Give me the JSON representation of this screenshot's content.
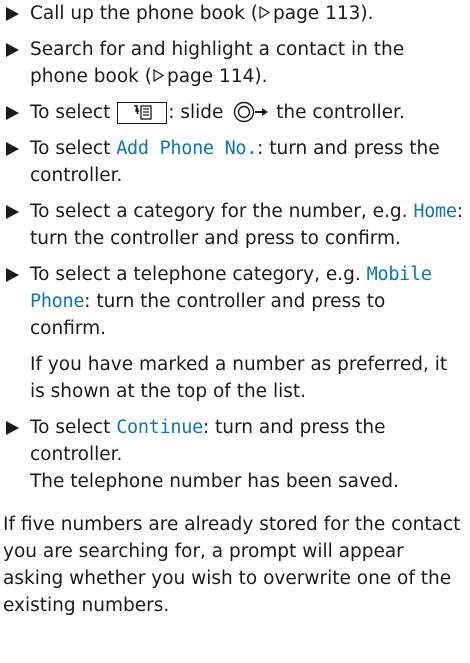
{
  "colors": {
    "text": "#1a1a1a",
    "highlight": "#0a78b4"
  },
  "icons": {
    "bullet": "triangle-right-bullet",
    "page_ref": "outline-triangle-right",
    "phone_book_entry": "phone-book-entry-icon",
    "controller": "controller-slide-icon"
  },
  "steps": [
    {
      "text_before": "Call up the phone book (",
      "ref": "page 113",
      "text_after": ")."
    },
    {
      "text_before": "Search for and highlight a contact in the phone book (",
      "ref": "page 114",
      "text_after": ")."
    },
    {
      "text_before": "To select ",
      "text_mid": ": slide ",
      "text_after": " the controller."
    },
    {
      "text_before": "To select ",
      "highlight": "Add Phone No.",
      "text_after": ": turn and press the controller."
    },
    {
      "text_before": "To select a category for the number, e.g. ",
      "highlight": "Home",
      "text_after": ": turn the controller and press to confirm."
    },
    {
      "text_before": "To select a telephone category, e.g. ",
      "highlight": "Mobile Phone",
      "text_after": ": turn the controller and press to confirm.",
      "note": "If you have marked a number as preferred, it is shown at the top of the list."
    },
    {
      "text_before": "To select ",
      "highlight": "Continue",
      "text_after": ": turn and press the controller.",
      "note": "The telephone number has been saved."
    }
  ],
  "closing_paragraph": "If five numbers are already stored for the contact you are searching for, a prompt will appear asking whether you wish to overwrite one of the existing numbers."
}
